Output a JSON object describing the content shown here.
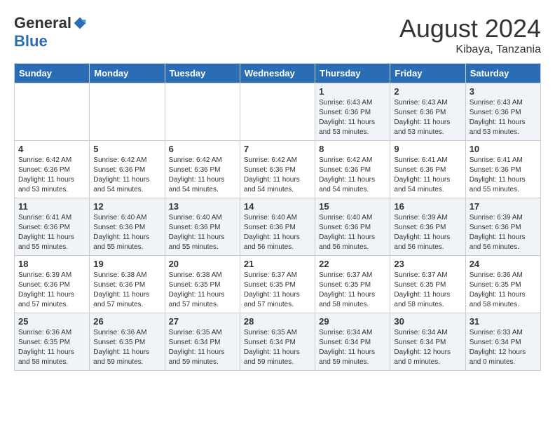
{
  "header": {
    "logo_general": "General",
    "logo_blue": "Blue",
    "month_year": "August 2024",
    "location": "Kibaya, Tanzania"
  },
  "days_of_week": [
    "Sunday",
    "Monday",
    "Tuesday",
    "Wednesday",
    "Thursday",
    "Friday",
    "Saturday"
  ],
  "weeks": [
    [
      {
        "day": "",
        "info": ""
      },
      {
        "day": "",
        "info": ""
      },
      {
        "day": "",
        "info": ""
      },
      {
        "day": "",
        "info": ""
      },
      {
        "day": "1",
        "info": "Sunrise: 6:43 AM\nSunset: 6:36 PM\nDaylight: 11 hours\nand 53 minutes."
      },
      {
        "day": "2",
        "info": "Sunrise: 6:43 AM\nSunset: 6:36 PM\nDaylight: 11 hours\nand 53 minutes."
      },
      {
        "day": "3",
        "info": "Sunrise: 6:43 AM\nSunset: 6:36 PM\nDaylight: 11 hours\nand 53 minutes."
      }
    ],
    [
      {
        "day": "4",
        "info": "Sunrise: 6:42 AM\nSunset: 6:36 PM\nDaylight: 11 hours\nand 53 minutes."
      },
      {
        "day": "5",
        "info": "Sunrise: 6:42 AM\nSunset: 6:36 PM\nDaylight: 11 hours\nand 54 minutes."
      },
      {
        "day": "6",
        "info": "Sunrise: 6:42 AM\nSunset: 6:36 PM\nDaylight: 11 hours\nand 54 minutes."
      },
      {
        "day": "7",
        "info": "Sunrise: 6:42 AM\nSunset: 6:36 PM\nDaylight: 11 hours\nand 54 minutes."
      },
      {
        "day": "8",
        "info": "Sunrise: 6:42 AM\nSunset: 6:36 PM\nDaylight: 11 hours\nand 54 minutes."
      },
      {
        "day": "9",
        "info": "Sunrise: 6:41 AM\nSunset: 6:36 PM\nDaylight: 11 hours\nand 54 minutes."
      },
      {
        "day": "10",
        "info": "Sunrise: 6:41 AM\nSunset: 6:36 PM\nDaylight: 11 hours\nand 55 minutes."
      }
    ],
    [
      {
        "day": "11",
        "info": "Sunrise: 6:41 AM\nSunset: 6:36 PM\nDaylight: 11 hours\nand 55 minutes."
      },
      {
        "day": "12",
        "info": "Sunrise: 6:40 AM\nSunset: 6:36 PM\nDaylight: 11 hours\nand 55 minutes."
      },
      {
        "day": "13",
        "info": "Sunrise: 6:40 AM\nSunset: 6:36 PM\nDaylight: 11 hours\nand 55 minutes."
      },
      {
        "day": "14",
        "info": "Sunrise: 6:40 AM\nSunset: 6:36 PM\nDaylight: 11 hours\nand 56 minutes."
      },
      {
        "day": "15",
        "info": "Sunrise: 6:40 AM\nSunset: 6:36 PM\nDaylight: 11 hours\nand 56 minutes."
      },
      {
        "day": "16",
        "info": "Sunrise: 6:39 AM\nSunset: 6:36 PM\nDaylight: 11 hours\nand 56 minutes."
      },
      {
        "day": "17",
        "info": "Sunrise: 6:39 AM\nSunset: 6:36 PM\nDaylight: 11 hours\nand 56 minutes."
      }
    ],
    [
      {
        "day": "18",
        "info": "Sunrise: 6:39 AM\nSunset: 6:36 PM\nDaylight: 11 hours\nand 57 minutes."
      },
      {
        "day": "19",
        "info": "Sunrise: 6:38 AM\nSunset: 6:36 PM\nDaylight: 11 hours\nand 57 minutes."
      },
      {
        "day": "20",
        "info": "Sunrise: 6:38 AM\nSunset: 6:35 PM\nDaylight: 11 hours\nand 57 minutes."
      },
      {
        "day": "21",
        "info": "Sunrise: 6:37 AM\nSunset: 6:35 PM\nDaylight: 11 hours\nand 57 minutes."
      },
      {
        "day": "22",
        "info": "Sunrise: 6:37 AM\nSunset: 6:35 PM\nDaylight: 11 hours\nand 58 minutes."
      },
      {
        "day": "23",
        "info": "Sunrise: 6:37 AM\nSunset: 6:35 PM\nDaylight: 11 hours\nand 58 minutes."
      },
      {
        "day": "24",
        "info": "Sunrise: 6:36 AM\nSunset: 6:35 PM\nDaylight: 11 hours\nand 58 minutes."
      }
    ],
    [
      {
        "day": "25",
        "info": "Sunrise: 6:36 AM\nSunset: 6:35 PM\nDaylight: 11 hours\nand 58 minutes."
      },
      {
        "day": "26",
        "info": "Sunrise: 6:36 AM\nSunset: 6:35 PM\nDaylight: 11 hours\nand 59 minutes."
      },
      {
        "day": "27",
        "info": "Sunrise: 6:35 AM\nSunset: 6:34 PM\nDaylight: 11 hours\nand 59 minutes."
      },
      {
        "day": "28",
        "info": "Sunrise: 6:35 AM\nSunset: 6:34 PM\nDaylight: 11 hours\nand 59 minutes."
      },
      {
        "day": "29",
        "info": "Sunrise: 6:34 AM\nSunset: 6:34 PM\nDaylight: 11 hours\nand 59 minutes."
      },
      {
        "day": "30",
        "info": "Sunrise: 6:34 AM\nSunset: 6:34 PM\nDaylight: 12 hours\nand 0 minutes."
      },
      {
        "day": "31",
        "info": "Sunrise: 6:33 AM\nSunset: 6:34 PM\nDaylight: 12 hours\nand 0 minutes."
      }
    ]
  ]
}
